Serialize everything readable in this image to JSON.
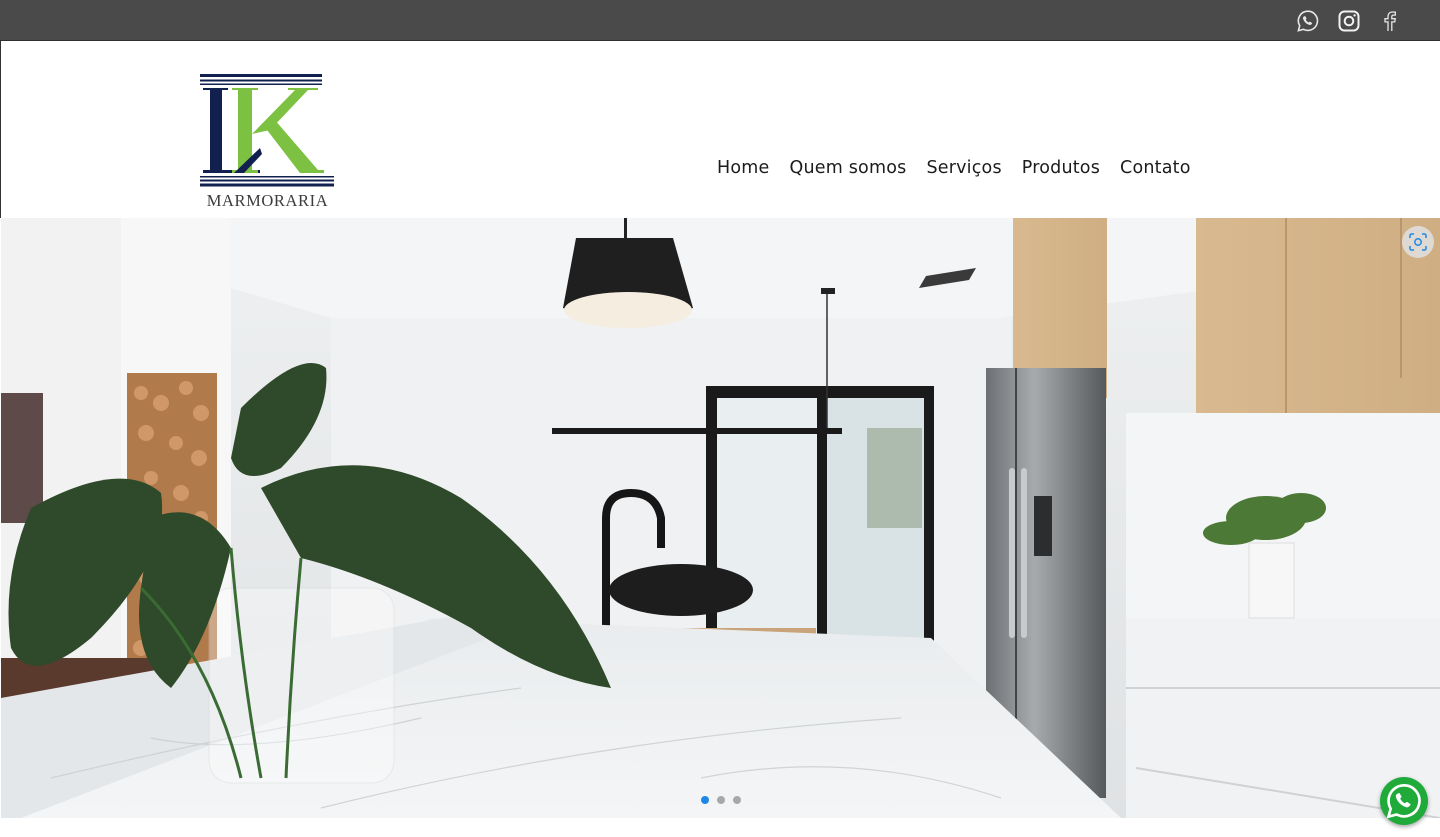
{
  "topbar": {
    "social": [
      {
        "icon": "whatsapp-icon"
      },
      {
        "icon": "instagram-icon"
      },
      {
        "icon": "facebook-icon"
      }
    ]
  },
  "logo": {
    "caption": "MARMORARIA",
    "colors": {
      "navy": "#12204f",
      "green": "#7dc142"
    }
  },
  "nav": {
    "items": [
      "Home",
      "Quem somos",
      "Serviços",
      "Produtos",
      "Contato"
    ]
  },
  "hero": {
    "image": "modern white kitchen with marble island, black pendant lamp, black faucet, stainless steel fridge and monstera leaves",
    "slides_total": 3,
    "active_slide": 1,
    "accent_color": "#1e88e5"
  },
  "floating_button": {
    "icon": "whatsapp-icon",
    "color": "#1faa3a"
  }
}
